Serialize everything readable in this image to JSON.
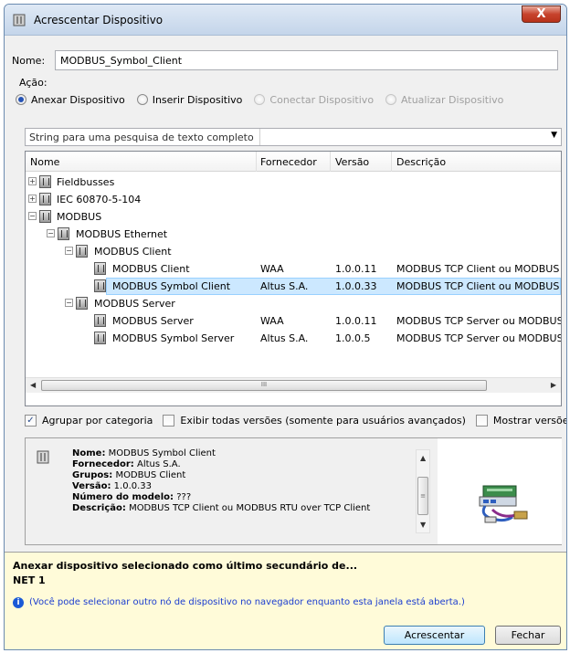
{
  "window": {
    "title": "Acrescentar Dispositivo",
    "close_glyph": "X"
  },
  "name_field": {
    "label": "Nome:",
    "value": "MODBUS_Symbol_Client"
  },
  "action": {
    "label": "Ação:",
    "options": [
      {
        "label": "Anexar Dispositivo",
        "selected": true,
        "enabled": true
      },
      {
        "label": "Inserir Dispositivo",
        "selected": false,
        "enabled": true
      },
      {
        "label": "Conectar Dispositivo",
        "selected": false,
        "enabled": false
      },
      {
        "label": "Atualizar Dispositivo",
        "selected": false,
        "enabled": false
      }
    ]
  },
  "search": {
    "placeholder": "String para uma pesquisa de texto completo"
  },
  "tree": {
    "columns": [
      "Nome",
      "Fornecedor",
      "Versão",
      "Descrição"
    ],
    "rows": [
      {
        "name": "Fieldbusses",
        "vendor": "",
        "version": "",
        "description": "",
        "expander": "+"
      },
      {
        "name": "IEC 60870-5-104",
        "vendor": "",
        "version": "",
        "description": "",
        "expander": "+"
      },
      {
        "name": "MODBUS",
        "vendor": "",
        "version": "",
        "description": "",
        "expander": "−"
      },
      {
        "name": "MODBUS Ethernet",
        "vendor": "",
        "version": "",
        "description": "",
        "expander": "−"
      },
      {
        "name": "MODBUS Client",
        "vendor": "",
        "version": "",
        "description": "",
        "expander": "−"
      },
      {
        "name": "MODBUS Client",
        "vendor": "WAA",
        "version": "1.0.0.11",
        "description": "MODBUS TCP Client ou MODBUS RTU",
        "expander": ""
      },
      {
        "name": "MODBUS Symbol Client",
        "vendor": "Altus S.A.",
        "version": "1.0.0.33",
        "description": "MODBUS TCP Client ou MODBUS RTU",
        "expander": "",
        "selected": true
      },
      {
        "name": "MODBUS Server",
        "vendor": "",
        "version": "",
        "description": "",
        "expander": "−"
      },
      {
        "name": "MODBUS Server",
        "vendor": "WAA",
        "version": "1.0.0.11",
        "description": "MODBUS TCP Server ou MODBUS RTU",
        "expander": ""
      },
      {
        "name": "MODBUS Symbol Server",
        "vendor": "Altus S.A.",
        "version": "1.0.0.5",
        "description": "MODBUS TCP Server ou MODBUS RTU",
        "expander": ""
      }
    ],
    "scroll_grip": "III"
  },
  "options": {
    "group_by_category": {
      "label": "Agrupar por categoria",
      "checked": true
    },
    "show_all_versions": {
      "label": "Exibir todas versões (somente para usuários avançados)",
      "checked": false
    },
    "show_old_versions": {
      "label": "Mostrar versões desatua",
      "checked": false
    }
  },
  "details": {
    "name_label": "Nome:",
    "name_value": "MODBUS Symbol Client",
    "vendor_label": "Fornecedor:",
    "vendor_value": "Altus S.A.",
    "groups_label": "Grupos:",
    "groups_value": "MODBUS Client",
    "version_label": "Versão:",
    "version_value": "1.0.0.33",
    "model_label": "Número do modelo:",
    "model_value": "???",
    "description_label": "Descrição:",
    "description_value": "MODBUS TCP Client ou MODBUS RTU over TCP Client",
    "scroll_grip": "≡"
  },
  "notice": {
    "title": "Anexar dispositivo selecionado como último secundário de...",
    "target": "NET 1",
    "info_glyph": "i",
    "info_text": "(Você pode selecionar outro nó de dispositivo no navegador enquanto esta janela está aberta.)"
  },
  "buttons": {
    "add": "Acrescentar",
    "close": "Fechar"
  }
}
